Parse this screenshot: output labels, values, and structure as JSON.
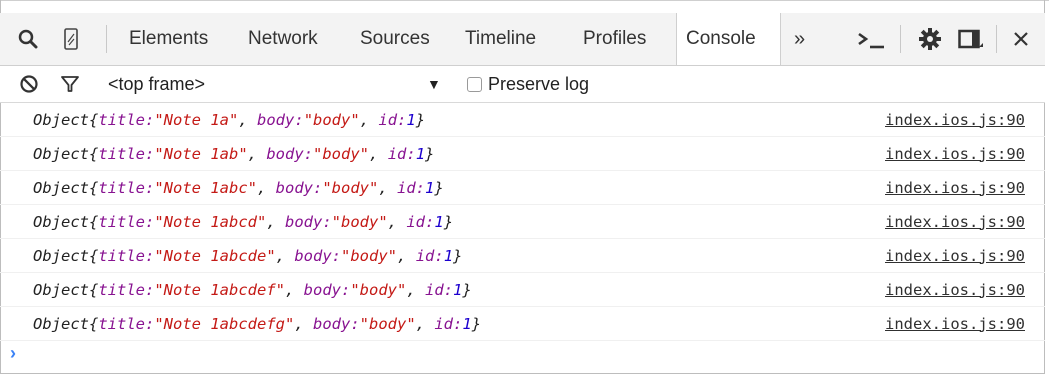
{
  "toolbar": {
    "tabs": [
      "Elements",
      "Network",
      "Sources",
      "Timeline",
      "Profiles",
      "Console"
    ],
    "more_label": "»",
    "active_tab": "Console"
  },
  "filter": {
    "frame_label": "<top frame>",
    "dropdown_arrow": "▼",
    "preserve_label": "Preserve log"
  },
  "console": {
    "rows": [
      {
        "object": "Object",
        "title_key": "title:",
        "title_val": "\"Note 1a\"",
        "body_key": "body:",
        "body_val": "\"body\"",
        "id_key": "id:",
        "id_val": "1",
        "source": "index.ios.js:90"
      },
      {
        "object": "Object",
        "title_key": "title:",
        "title_val": "\"Note 1ab\"",
        "body_key": "body:",
        "body_val": "\"body\"",
        "id_key": "id:",
        "id_val": "1",
        "source": "index.ios.js:90"
      },
      {
        "object": "Object",
        "title_key": "title:",
        "title_val": "\"Note 1abc\"",
        "body_key": "body:",
        "body_val": "\"body\"",
        "id_key": "id:",
        "id_val": "1",
        "source": "index.ios.js:90"
      },
      {
        "object": "Object",
        "title_key": "title:",
        "title_val": "\"Note 1abcd\"",
        "body_key": "body:",
        "body_val": "\"body\"",
        "id_key": "id:",
        "id_val": "1",
        "source": "index.ios.js:90"
      },
      {
        "object": "Object",
        "title_key": "title:",
        "title_val": "\"Note 1abcde\"",
        "body_key": "body:",
        "body_val": "\"body\"",
        "id_key": "id:",
        "id_val": "1",
        "source": "index.ios.js:90"
      },
      {
        "object": "Object",
        "title_key": "title:",
        "title_val": "\"Note 1abcdef\"",
        "body_key": "body:",
        "body_val": "\"body\"",
        "id_key": "id:",
        "id_val": "1",
        "source": "index.ios.js:90"
      },
      {
        "object": "Object",
        "title_key": "title:",
        "title_val": "\"Note 1abcdefg\"",
        "body_key": "body:",
        "body_val": "\"body\"",
        "id_key": "id:",
        "id_val": "1",
        "source": "index.ios.js:90"
      }
    ],
    "prompt": "›"
  },
  "colors": {
    "key": "#881391",
    "string": "#c41a16",
    "number": "#1c00cf",
    "prompt": "#3b82f6"
  }
}
